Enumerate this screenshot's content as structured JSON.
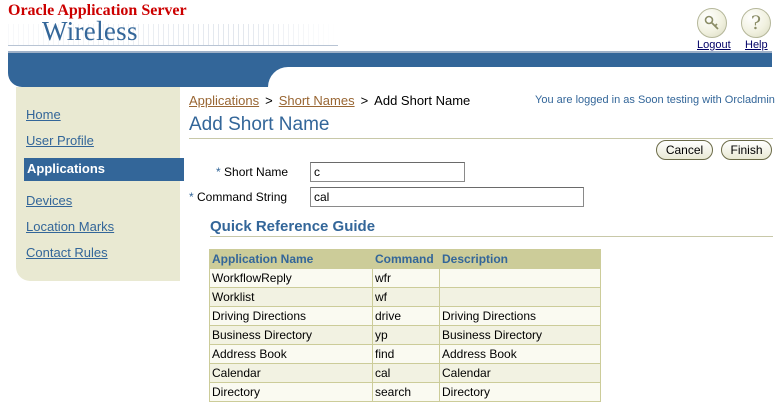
{
  "header": {
    "brand_top": "Oracle Application Server",
    "brand_main": "Wireless",
    "logout_label": "Logout",
    "help_label": "Help",
    "logout_icon": "key-icon",
    "help_icon": "question-mark-icon"
  },
  "sidebar": {
    "items": [
      {
        "label": "Home",
        "active": false
      },
      {
        "label": "User Profile",
        "active": false
      },
      {
        "label": "Applications",
        "active": true
      },
      {
        "label": "Devices",
        "active": false
      },
      {
        "label": "Location Marks",
        "active": false
      },
      {
        "label": "Contact Rules",
        "active": false
      }
    ]
  },
  "breadcrumb": {
    "items": [
      "Applications",
      "Short Names"
    ],
    "separator": ">",
    "current": "Add Short Name"
  },
  "login_status": "You are logged in as Soon testing with Orcladmin",
  "page_title": "Add Short Name",
  "buttons": {
    "cancel": "Cancel",
    "finish": "Finish"
  },
  "form": {
    "required_marker": "*",
    "short_name": {
      "label": "Short Name",
      "value": "c"
    },
    "command_string": {
      "label": "Command String",
      "value": "cal"
    }
  },
  "quick_reference": {
    "title": "Quick Reference Guide",
    "columns": [
      "Application Name",
      "Command",
      "Description"
    ],
    "rows": [
      [
        "WorkflowReply",
        "wfr",
        ""
      ],
      [
        "Worklist",
        "wf",
        ""
      ],
      [
        "Driving Directions",
        "drive",
        "Driving Directions"
      ],
      [
        "Business Directory",
        "yp",
        "Business Directory"
      ],
      [
        "Address Book",
        "find",
        "Address Book"
      ],
      [
        "Calendar",
        "cal",
        "Calendar"
      ],
      [
        "Directory",
        "search",
        "Directory"
      ]
    ]
  },
  "colors": {
    "brand_red": "#cc0000",
    "accent_blue": "#336699",
    "sidebar_bg": "#e9e9d2",
    "table_header_bg": "#cccc99",
    "breadcrumb_link": "#996633"
  }
}
